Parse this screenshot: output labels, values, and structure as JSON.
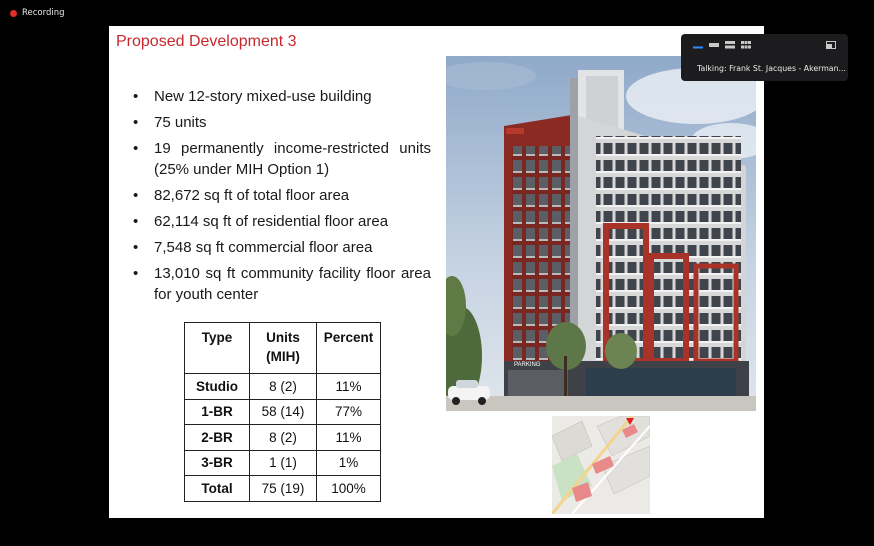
{
  "recording": {
    "label": "Recording"
  },
  "slide": {
    "title": "Proposed Development 3",
    "bullets": [
      "New 12-story mixed-use building",
      "75 units",
      "19 permanently income-restricted units (25% under MIH Option 1)",
      "82,672 sq ft of total floor area",
      "62,114 sq ft of residential floor area",
      "7,548 sq ft commercial floor area",
      "13,010 sq ft community facility floor area for youth center"
    ],
    "table": {
      "headers": [
        "Type",
        "Units\n(MIH)",
        "Percent"
      ],
      "rows": [
        [
          "Studio",
          "8 (2)",
          "11%"
        ],
        [
          "1-BR",
          "58 (14)",
          "77%"
        ],
        [
          "2-BR",
          "8 (2)",
          "11%"
        ],
        [
          "3-BR",
          "1 (1)",
          "1%"
        ],
        [
          "Total",
          "75 (19)",
          "100%"
        ]
      ]
    },
    "rendering": {
      "sign_text": "PARKING"
    }
  },
  "zoom_panel": {
    "talking": "Talking: Frank St. Jacques - Akerman..."
  },
  "colors": {
    "accent_red": "#c8282d",
    "recording_red": "#e0302a",
    "accent_blue": "#2d8cff"
  }
}
